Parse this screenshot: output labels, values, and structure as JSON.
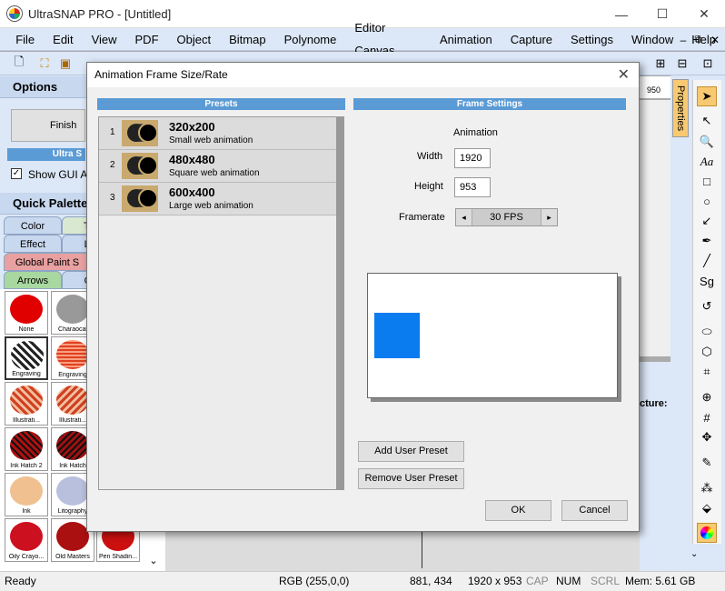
{
  "window": {
    "title": "UltraSNAP PRO - [Untitled]",
    "minimize": "—",
    "maximize": "☐",
    "close": "✕"
  },
  "menu": [
    "File",
    "Edit",
    "View",
    "PDF",
    "Object",
    "Bitmap",
    "Polynome",
    "Editor Canvas",
    "Animation",
    "Capture",
    "Settings",
    "Window",
    "Help"
  ],
  "mdi": {
    "minimize": "–",
    "restore": "⧉",
    "close": "✕"
  },
  "ruler": {
    "mark": "950"
  },
  "left_panel": {
    "options_title": "Options",
    "finish_label": "Finish E",
    "ultra_label": "Ultra S",
    "show_gui_label": "Show GUI Af",
    "show_gui_checked": true,
    "quick_palette_title": "Quick Palette",
    "tabs": [
      [
        "Color",
        "Tra"
      ],
      [
        "Effect",
        "Lig"
      ],
      [
        "Global Paint S"
      ],
      [
        "Arrows",
        "Ob"
      ]
    ],
    "swatches": [
      {
        "label": "None",
        "color": "#e00000"
      },
      {
        "label": "Charaocal",
        "color": "#888888"
      },
      {
        "label": "Engraving",
        "color": "#444444"
      },
      {
        "label": "Engraving",
        "color": "#e04020"
      },
      {
        "label": "Illustrati...",
        "color": "#d04020"
      },
      {
        "label": "Illustrati...",
        "color": "#d04020"
      },
      {
        "label": "Ink Hatch 2",
        "color": "#b01010"
      },
      {
        "label": "Ink Hatch",
        "color": "#a01010"
      },
      {
        "label": "Ink",
        "color": "#f0c090"
      },
      {
        "label": "Litography",
        "color": "#8899cc"
      },
      {
        "label": "Oily Crayo...",
        "color": "#cc1020"
      },
      {
        "label": "Old Masters",
        "color": "#aa1010"
      },
      {
        "label": "Pen Shadin...",
        "color": "#cc1010"
      }
    ]
  },
  "right_panel": {
    "properties_tab": "Properties",
    "partial_text": "cture:"
  },
  "dialog": {
    "title": "Animation Frame Size/Rate",
    "close": "✕",
    "presets_header": "Presets",
    "frame_header": "Frame Settings",
    "presets": [
      {
        "num": "1",
        "name": "320x200",
        "desc": "Small web animation"
      },
      {
        "num": "2",
        "name": "480x480",
        "desc": "Square web animation"
      },
      {
        "num": "3",
        "name": "600x400",
        "desc": "Large web animation"
      }
    ],
    "animation_label": "Animation",
    "width_label": "Width",
    "width_value": "1920",
    "height_label": "Height",
    "height_value": "953",
    "framerate_label": "Framerate",
    "framerate_value": "30 FPS",
    "preview_color": "#0a7cf0",
    "add_preset": "Add User Preset",
    "remove_preset": "Remove User Preset",
    "ok": "OK",
    "cancel": "Cancel"
  },
  "status": {
    "ready": "Ready",
    "rgb": "RGB (255,0,0)",
    "coords": "881, 434",
    "size": "1920 x 953",
    "cap": "CAP",
    "num": "NUM",
    "scrl": "SCRL",
    "mem": "Mem: 5.61 GB"
  }
}
